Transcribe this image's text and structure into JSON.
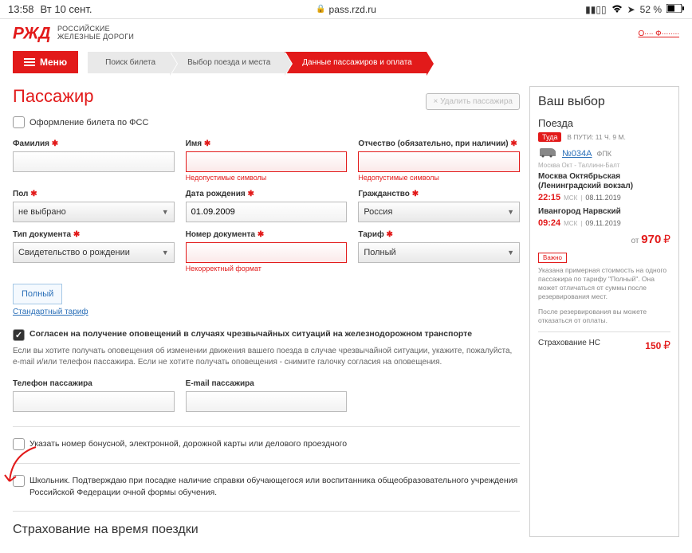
{
  "status": {
    "time": "13:58",
    "date": "Вт 10 сент.",
    "url": "pass.rzd.ru",
    "battery": "52 %"
  },
  "logo": {
    "line1": "Российские",
    "line2": "железные дороги"
  },
  "top_link": "О∙∙∙∙ Ф∙∙∙∙∙∙∙∙",
  "menu": {
    "label": "Меню"
  },
  "crumbs": {
    "c1": "Поиск билета",
    "c2": "Выбор поезда и места",
    "c3": "Данные пассажиров и оплата"
  },
  "page_title": "Пассажир",
  "delete_btn": "Удалить пассажира",
  "fss_label": "Оформление билета по ФСС",
  "fields": {
    "surname": "Фамилия",
    "name": "Имя",
    "patronymic": "Отчество (обязательно, при наличии)",
    "sex": "Пол",
    "dob": "Дата рождения",
    "citizenship": "Гражданство",
    "doc_type": "Тип документа",
    "doc_num": "Номер документа",
    "tariff": "Тариф"
  },
  "values": {
    "sex": "не выбрано",
    "dob": "01.09.2009",
    "citizenship": "Россия",
    "doc_type": "Свидетельство о рождении",
    "tariff": "Полный"
  },
  "errors": {
    "invalid_chars": "Недопустимые символы",
    "bad_format": "Некорректный формат"
  },
  "tariff_box": "Полный",
  "tariff_link": "Стандартный тариф",
  "consent": {
    "title": "Согласен на получение оповещений в случаях чрезвычайных ситуаций на железнодорожном транспорте",
    "desc": "Если вы хотите получать оповещения об изменении движения вашего поезда в случае чрезвычайной ситуации, укажите, пожалуйста, e-mail и/или телефон пассажира.\nЕсли не хотите получать оповещения - снимите галочку согласия на оповещения."
  },
  "contact": {
    "phone": "Телефон пассажира",
    "email": "E-mail пассажира"
  },
  "bonus": "Указать номер бонусной, электронной, дорожной карты или делового проездного",
  "student": "Школьник. Подтверждаю при посадке наличие справки обучающегося или воспитанника общеобразовательного учреждения Российской Федерации очной формы обучения.",
  "insurance_trip": "Страхование на время поездки",
  "sidebar": {
    "title": "Ваш выбор",
    "trains_label": "Поезда",
    "direction": "Туда",
    "duration": "В ПУТИ: 11 Ч. 9 М.",
    "train_no": "№034А",
    "train_type": "ФПК",
    "route_small": "Москва Окт - Таллинн-Балт",
    "station_from": "Москва Октябрьская (Ленинградский вокзал)",
    "time_from": "22:15",
    "tz": "МСК",
    "date_from": "08.11.2019",
    "station_to": "Ивангород Нарвский",
    "time_to": "09:24",
    "date_to": "09.11.2019",
    "from_label": "от",
    "price": "970",
    "warn": "Важно",
    "note1": "Указана примерная стоимость на одного пассажира по тарифу \"Полный\". Она может отличаться от суммы после резервирования мест.",
    "note2": "После резервирования вы можете отказаться от оплаты.",
    "ins_label": "Страхование НС",
    "ins_price": "150"
  }
}
